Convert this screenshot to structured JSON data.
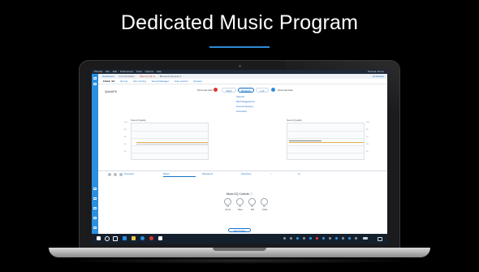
{
  "slide": {
    "title": "Dedicated Music Program"
  },
  "window": {
    "title": "Phonak",
    "menus": [
      "File",
      "Edit",
      "Preferences",
      "Tools",
      "Options",
      "Help"
    ],
    "user": "Phonak, Demo"
  },
  "tabs": {
    "items": [
      "Dashboard",
      "Find Simulator",
      "(Demo) Icon A",
      "Bluetooth Devices 2"
    ],
    "right_label": "Handle",
    "right_link": "Fit Module"
  },
  "subnav": {
    "items": [
      "Fitted: 4/4",
      "Set Up",
      "Fine Tuning",
      "Sound Manager",
      "Auto Control",
      "Session"
    ]
  },
  "quickfit": {
    "title": "QuickFit",
    "volume_label": "Personal Gain",
    "right": "Right",
    "binaural": "Binaural",
    "left": "Left",
    "left_volume_label": "Personal Gain"
  },
  "options": [
    "Speech",
    "Mild Suggestions",
    "Sound Hopping",
    "Acoustics"
  ],
  "plots": [
    {
      "label": "Sound Quality",
      "yticks": [
        "100",
        "80",
        "60",
        "40",
        "20"
      ]
    },
    {
      "label": "Sound Quality",
      "yticks": [
        "100",
        "80",
        "60",
        "40",
        "20"
      ]
    }
  ],
  "toolbar": {
    "items": [
      "Precision",
      "Music",
      "Situations",
      "Favorites",
      "",
      ""
    ]
  },
  "eq": {
    "title": "Music EQ Controls",
    "knobs": [
      "All Ind.",
      "Bass",
      "Mid",
      "Treble"
    ]
  },
  "find_button": "Run Tuning",
  "colors": {
    "accent": "#2b8fe0",
    "rule": "#2d8bd8",
    "background": "#000000"
  }
}
